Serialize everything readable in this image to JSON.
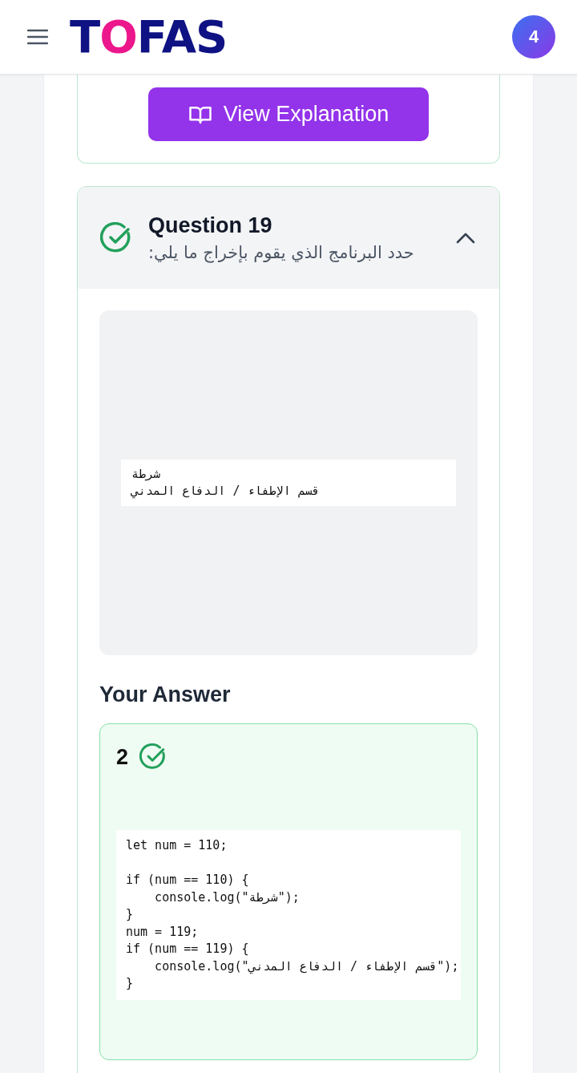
{
  "header": {
    "logo": {
      "lead": "T",
      "accent": "O",
      "rest": "FAS"
    },
    "badge": "4"
  },
  "previous_card": {
    "button": "View Explanation"
  },
  "question": {
    "title": "Question 19",
    "prompt": "حدد البرنامج الذي يقوم بإخراج ما يلي:",
    "correct": true,
    "expanded": true,
    "output_lines": [
      "شرطة",
      "قسم الإطفاء / الدفاع المدني"
    ],
    "answer_heading": "Your Answer",
    "answer": {
      "label": "2",
      "correct": true,
      "code": "let num = 110;\n\nif (num == 110) {\n    console.log(\"شرطة\");\n}\nnum = 119;\nif (num == 119) {\n    console.log(\"قسم الإطفاء / الدفاع المدني\");\n}"
    }
  }
}
